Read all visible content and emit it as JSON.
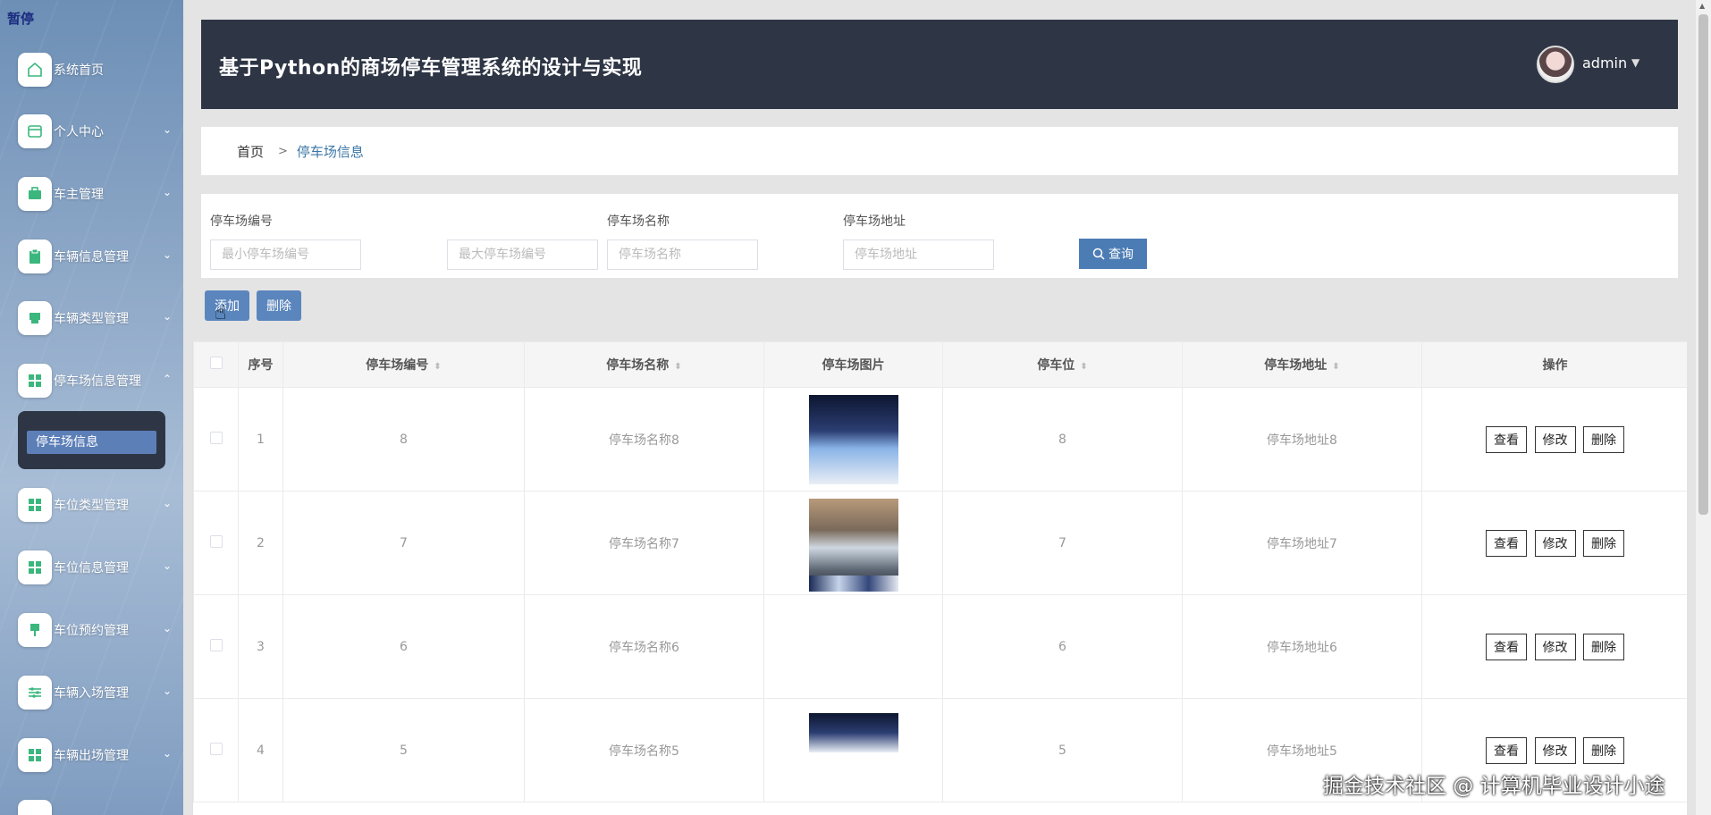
{
  "sidebar": {
    "pause_label": "暂停",
    "items": [
      {
        "label": "系统首页",
        "icon": "home-icon",
        "chevron": ""
      },
      {
        "label": "个人中心",
        "icon": "card-icon",
        "chevron": "⌄"
      },
      {
        "label": "车主管理",
        "icon": "briefcase-icon",
        "chevron": "⌄"
      },
      {
        "label": "车辆信息管理",
        "icon": "clipboard-icon",
        "chevron": "⌄"
      },
      {
        "label": "车辆类型管理",
        "icon": "printer-icon",
        "chevron": "⌄"
      },
      {
        "label": "停车场信息管理",
        "icon": "grid-icon",
        "chevron": "⌃"
      },
      {
        "label": "车位类型管理",
        "icon": "grid-icon",
        "chevron": "⌄"
      },
      {
        "label": "车位信息管理",
        "icon": "grid-icon",
        "chevron": "⌄"
      },
      {
        "label": "车位预约管理",
        "icon": "pin-icon",
        "chevron": "⌄"
      },
      {
        "label": "车辆入场管理",
        "icon": "sliders-icon",
        "chevron": "⌄"
      },
      {
        "label": "车辆出场管理",
        "icon": "grid-icon",
        "chevron": "⌄"
      }
    ],
    "submenu_item": "停车场信息"
  },
  "header": {
    "title": "基于Python的商场停车管理系统的设计与实现",
    "user": "admin"
  },
  "breadcrumb": {
    "home": "首页",
    "separator": ">",
    "current": "停车场信息"
  },
  "search": {
    "label_number": "停车场编号",
    "label_name": "停车场名称",
    "label_address": "停车场地址",
    "min_number_placeholder": "最小停车场编号",
    "max_number_placeholder": "最大停车场编号",
    "name_placeholder": "停车场名称",
    "address_placeholder": "停车场地址",
    "query_label": "查询"
  },
  "actions": {
    "add_label": "添加",
    "delete_label": "删除"
  },
  "table": {
    "headers": [
      "序号",
      "停车场编号",
      "停车场名称",
      "停车场图片",
      "停车位",
      "停车场地址",
      "操作"
    ],
    "rows": [
      {
        "index": "1",
        "number": "8",
        "name": "停车场名称8",
        "spaces": "8",
        "address": "停车场地址8"
      },
      {
        "index": "2",
        "number": "7",
        "name": "停车场名称7",
        "spaces": "7",
        "address": "停车场地址7"
      },
      {
        "index": "3",
        "number": "6",
        "name": "停车场名称6",
        "spaces": "6",
        "address": "停车场地址6"
      },
      {
        "index": "4",
        "number": "5",
        "name": "停车场名称5",
        "spaces": "5",
        "address": "停车场地址5"
      }
    ],
    "view_label": "查看",
    "edit_label": "修改",
    "delete_label": "删除"
  },
  "watermark": "掘金技术社区 @ 计算机毕业设计小途",
  "colors": {
    "header_bg": "#2e3645",
    "primary_button": "#4c7cb4",
    "breadcrumb_active": "#3a76a6"
  }
}
